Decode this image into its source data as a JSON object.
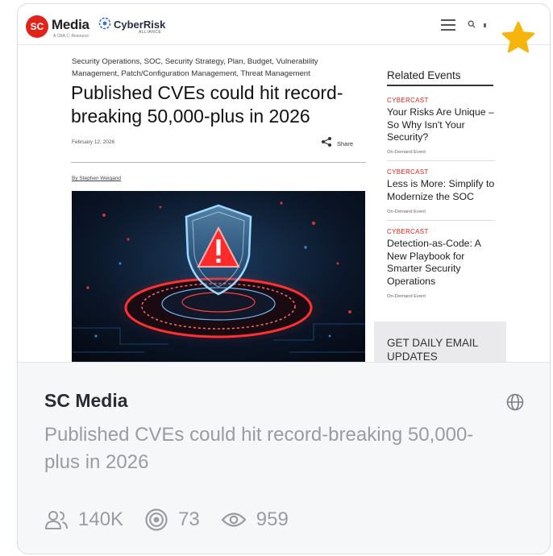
{
  "site_preview": {
    "logo_badge": "SC",
    "logo_word": "Media",
    "logo_sub": "A CRA Ⓒ Resource",
    "partner_word": "CyberRisk",
    "partner_sub": "ALLIANCE",
    "search_glyph": "Q",
    "article": {
      "tags": "Security Operations, SOC, Security Strategy, Plan, Budget, Vulnerability Management, Patch/Configuration Management, Threat Management",
      "headline": "Published CVEs could hit record-breaking 50,000-plus in 2026",
      "date": "February 12, 2026",
      "share_label": "Share",
      "author": "By Stephen Weigand"
    },
    "related": {
      "title": "Related Events",
      "events": [
        {
          "category": "CYBERCAST",
          "title": "Your Risks Are Unique – So Why Isn't Your Security?",
          "meta": "On-Demand Event"
        },
        {
          "category": "CYBERCAST",
          "title": "Less is More: Simplify to Modernize the SOC",
          "meta": "On-Demand Event"
        },
        {
          "category": "CYBERCAST",
          "title": "Detection-as-Code: A New Playbook for Smarter Security Operations",
          "meta": "On-Demand Event"
        }
      ],
      "email_cta": "GET DAILY EMAIL UPDATES"
    }
  },
  "card": {
    "source_name": "SC Media",
    "title": "Published CVEs could hit record-breaking 50,000-plus in 2026",
    "stats": {
      "followers": "140K",
      "target": "73",
      "views": "959"
    }
  },
  "icons": {
    "favorite": "star-icon",
    "globe": "globe-icon",
    "followers": "users-icon",
    "target": "target-icon",
    "views": "eye-icon",
    "menu": "hamburger-icon",
    "share": "share-icon"
  },
  "colors": {
    "star": "#f5b50a",
    "brand_red": "#e2231a",
    "muted_text": "#9a9ca3",
    "card_bg": "#f6f7f9"
  }
}
